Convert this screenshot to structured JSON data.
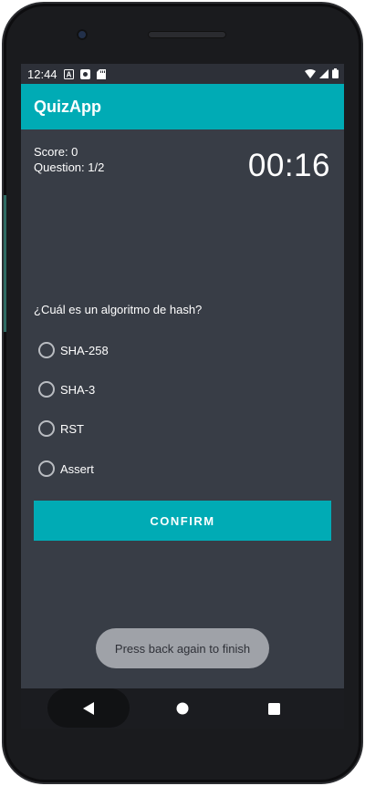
{
  "status_bar": {
    "time": "12:44",
    "left_icons": [
      "a-box-icon",
      "p-box-icon",
      "sd-card-icon"
    ],
    "right_icons": [
      "wifi-icon",
      "signal-icon",
      "battery-icon"
    ]
  },
  "app_bar": {
    "title": "QuizApp",
    "color": "#00abb5"
  },
  "quiz": {
    "score": "Score: 0",
    "question_count": "Question: 1/2",
    "timer": "00:16",
    "question": "¿Cuál es un algoritmo de hash?",
    "options": [
      "SHA-258",
      "SHA-3",
      "RST",
      "Assert"
    ],
    "confirm_label": "CONFIRM"
  },
  "toast": {
    "message": "Press back again to finish"
  },
  "nav_bar": {
    "buttons": [
      "back-icon",
      "home-icon",
      "recents-icon"
    ]
  }
}
